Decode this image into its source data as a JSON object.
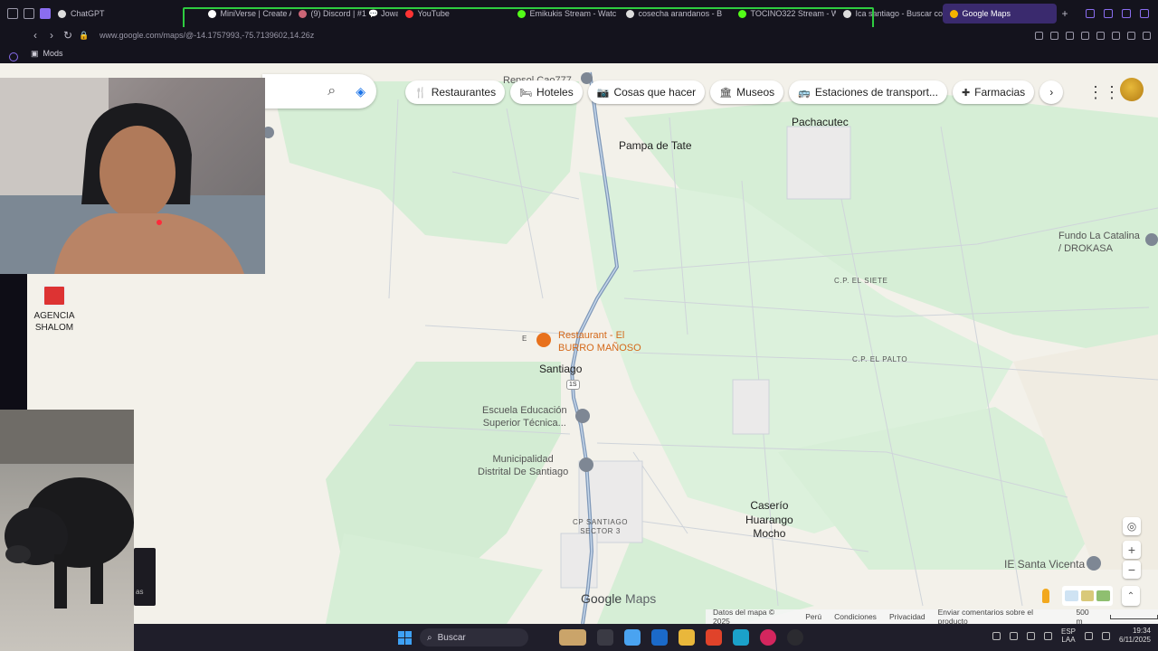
{
  "browser": {
    "tabs": [
      {
        "label": "ChatGPT",
        "color": "#dddddd",
        "active": false
      },
      {
        "label": "MiniVerse | Create Ama",
        "color": "#cc6677",
        "active": false
      },
      {
        "label": "(9) Discord | #1 💬 Jowa",
        "color": "#cc6677",
        "active": false
      },
      {
        "label": "YouTube",
        "color": "#ff3333",
        "active": false
      },
      {
        "label": "Emikukis Stream - Watc",
        "color": "#53fc18",
        "active": false
      },
      {
        "label": "cosecha arandanos - B",
        "color": "#dddddd",
        "active": false
      },
      {
        "label": "TOCINO322 Stream - W",
        "color": "#53fc18",
        "active": false
      },
      {
        "label": "Ica santiago - Buscar co",
        "color": "#dddddd",
        "active": false
      },
      {
        "label": "Google Maps",
        "color": "#f5b400",
        "active": true
      }
    ],
    "new_tab": "+",
    "url": "www.google.com/maps/@-14.1757993,-75.7139602,14.26z",
    "bookmark": "Mods"
  },
  "maps": {
    "chips": [
      {
        "icon": "🍴",
        "label": "Restaurantes",
        "icon_name": "restaurant-icon"
      },
      {
        "icon": "🛏",
        "label": "Hoteles",
        "icon_name": "hotel-icon"
      },
      {
        "icon": "📷",
        "label": "Cosas que hacer",
        "icon_name": "camera-icon"
      },
      {
        "icon": "🏛",
        "label": "Museos",
        "icon_name": "museum-icon"
      },
      {
        "icon": "🚌",
        "label": "Estaciones de transport...",
        "icon_name": "transit-icon"
      },
      {
        "icon": "✚",
        "label": "Farmacias",
        "icon_name": "pharmacy-icon"
      }
    ],
    "chip_next": "›",
    "places": {
      "pachacutec": "Pachacutec",
      "pampa_de_tate": "Pampa de Tate",
      "repsol": "Repsol Cao777",
      "fundo_line1": "Fundo La Catalina",
      "fundo_line2": "/ DROKASA",
      "cp_el_siete": "C.P. EL SIETE",
      "cp_el_palto": "C.P. EL PALTO",
      "restaurant_line1": "Restaurant - El",
      "restaurant_line2": "BURRO MAÑOSO",
      "letter_e": "E",
      "santiago": "Santiago",
      "route": "1S",
      "escuela_line1": "Escuela Educación",
      "escuela_line2": "Superior Técnica...",
      "municipalidad_line1": "Municipalidad",
      "municipalidad_line2": "Distrital De Santiago",
      "cp_santiago_line1": "CP SANTIAGO",
      "cp_santiago_line2": "SECTOR 3",
      "caserio_line1": "Caserío",
      "caserio_line2": "Huarango",
      "caserio_line3": "Mocho",
      "ie_santa_vicenta": "IE Santa Vicenta"
    },
    "google_logo": "Google",
    "maps_word": "Maps",
    "footer": {
      "data": "Datos del mapa © 2025",
      "country": "Perú",
      "terms": "Condiciones",
      "privacy": "Privacidad",
      "feedback": "Enviar comentarios sobre el producto",
      "scale": "500 m"
    },
    "zoom_in": "+",
    "zoom_out": "−"
  },
  "overlays": {
    "desktop_icon_line1": "AGENCIA",
    "desktop_icon_line2": "SHALOM",
    "thumb_text": "as"
  },
  "taskbar": {
    "search_placeholder": "Buscar",
    "lang_line1": "ESP",
    "lang_line2": "LAA",
    "time": "19:34",
    "date": "6/11/2025"
  },
  "colors": {
    "accent": "#8a6df0",
    "map_bg": "#f3f1ea",
    "map_green": "#d8efd8",
    "road": "#7f98b8",
    "highlight": "#2ecc40"
  }
}
